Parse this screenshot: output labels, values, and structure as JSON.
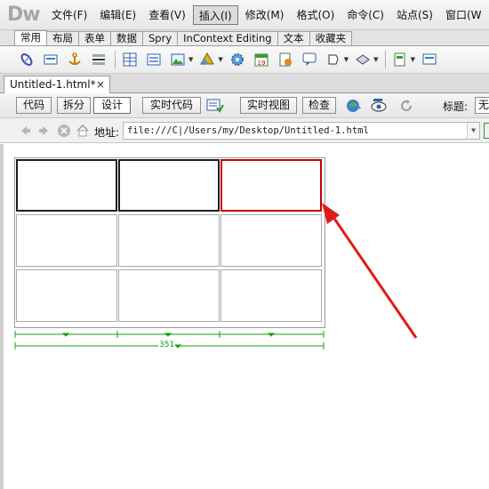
{
  "app": {
    "logo": "Dw"
  },
  "menu": [
    {
      "label": "文件(F)"
    },
    {
      "label": "编辑(E)"
    },
    {
      "label": "查看(V)"
    },
    {
      "label": "插入(I)",
      "active": true
    },
    {
      "label": "修改(M)"
    },
    {
      "label": "格式(O)"
    },
    {
      "label": "命令(C)"
    },
    {
      "label": "站点(S)"
    },
    {
      "label": "窗口(W"
    }
  ],
  "insert_tabs": [
    {
      "label": "常用",
      "active": true
    },
    {
      "label": "布局"
    },
    {
      "label": "表单"
    },
    {
      "label": "数据"
    },
    {
      "label": "Spry"
    },
    {
      "label": "InContext Editing"
    },
    {
      "label": "文本"
    },
    {
      "label": "收藏夹"
    }
  ],
  "toolbar_icons": [
    "hyperlink-icon",
    "email-link-icon",
    "named-anchor-icon",
    "horizontal-rule-icon",
    "table-icon",
    "insert-div-icon",
    "images-icon",
    "media-icon",
    "date-icon",
    "server-side-include-icon",
    "comment-icon",
    "head-tags-icon",
    "script-icon",
    "templates-icon",
    "tag-chooser-icon"
  ],
  "document": {
    "tab_title": "Untitled-1.html*",
    "close": "×"
  },
  "view": {
    "code": "代码",
    "split": "拆分",
    "design": "设计",
    "live_code": "实时代码",
    "live_view": "实时视图",
    "inspect": "检查",
    "title_label": "标题:",
    "title_value": "无"
  },
  "address": {
    "label": "地址:",
    "value": "file:///C|/Users/my/Desktop/Untitled-1.html"
  },
  "table": {
    "rows": 3,
    "cols": 3,
    "total_width": "351"
  },
  "colors": {
    "accent_green": "#13a313",
    "annotation_red": "#e01b1b",
    "selected_cell_border": "#1d1d1d"
  }
}
